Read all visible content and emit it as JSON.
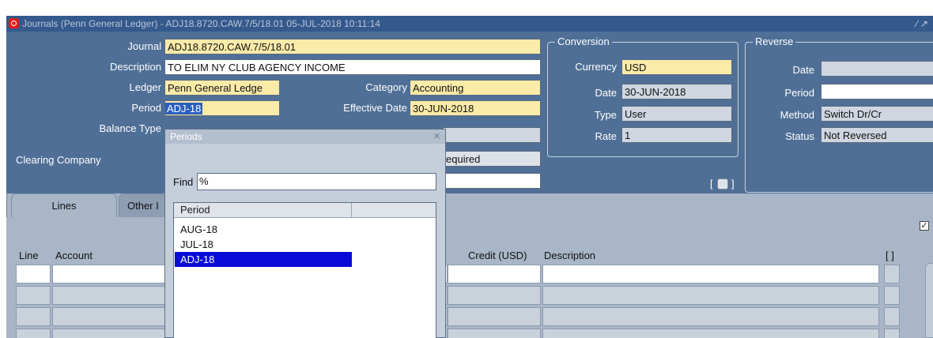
{
  "window": {
    "title": "Journals (Penn General Ledger) - ADJ18.8720.CAW.7/5/18.01 05-JUL-2018 10:11:14",
    "controls": "⁄ ↗"
  },
  "journal": {
    "journal_label": "Journal",
    "journal_value": "ADJ18.8720.CAW.7/5/18.01",
    "description_label": "Description",
    "description_value": "TO ELIM NY CLUB AGENCY INCOME",
    "ledger_label": "Ledger",
    "ledger_value": "Penn General Ledge",
    "category_label": "Category",
    "category_value": "Accounting",
    "period_label": "Period",
    "period_value": "ADJ-18",
    "effective_date_label": "Effective Date",
    "effective_date_value": "30-JUN-2018",
    "balance_type_label": "Balance Type",
    "clearing_company_label": "Clearing Company",
    "partial_hidden_value": "equired"
  },
  "conversion": {
    "group_title": "Conversion",
    "currency_label": "Currency",
    "currency_value": "USD",
    "date_label": "Date",
    "date_value": "30-JUN-2018",
    "type_label": "Type",
    "type_value": "User",
    "rate_label": "Rate",
    "rate_value": "1"
  },
  "reverse": {
    "group_title": "Reverse",
    "date_label": "Date",
    "date_value": "",
    "period_label": "Period",
    "period_value": "",
    "method_label": "Method",
    "method_value": "Switch Dr/Cr",
    "status_label": "Status",
    "status_value": "Not Reversed"
  },
  "tabs": [
    {
      "label": "Lines"
    },
    {
      "label": "Other I"
    }
  ],
  "lines": {
    "col_line": "Line",
    "col_account": "Account",
    "col_credit": "Credit (USD)",
    "col_description": "Description",
    "col_flex": "[ ]",
    "dff_button": "[ ]"
  },
  "popup": {
    "title": "Periods",
    "close": "×",
    "find_label": "Find",
    "find_value": "%",
    "list_header": "Period",
    "items": [
      {
        "label": "AUG-18"
      },
      {
        "label": "JUL-18"
      },
      {
        "label": "ADJ-18"
      }
    ]
  },
  "colors": {
    "header_bg": "#4f6f96",
    "required_field": "#fbeba9",
    "selected_row": "#0a0ad8",
    "title_bar": "#34598d"
  },
  "icons": {
    "app_icon": "oracle-icon",
    "close": "close-icon",
    "checkbox": "checkbox-checked-icon"
  }
}
